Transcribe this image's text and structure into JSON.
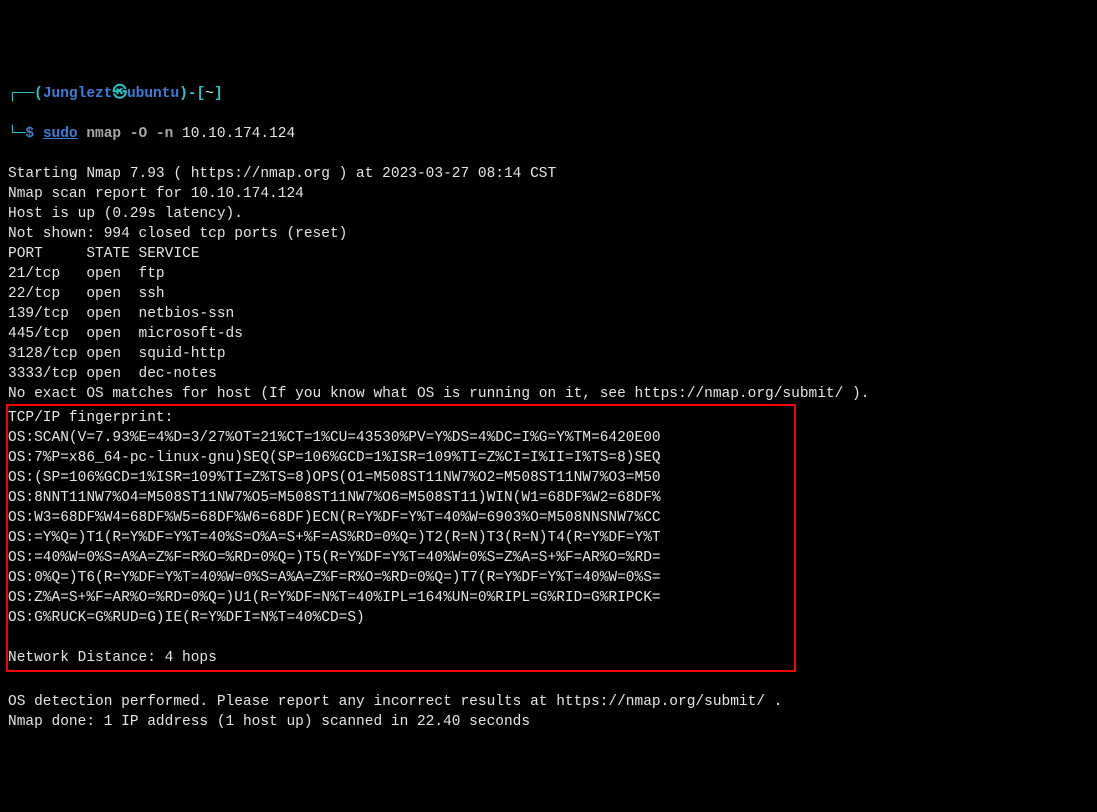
{
  "prompt1": {
    "bracket_open": "┌──(",
    "user": "Junglezt",
    "at": "㉿",
    "host": "ubuntu",
    "bracket_close": ")-[",
    "path": "~",
    "bracket_end": "]"
  },
  "prompt2": {
    "branch": "└─",
    "dollar": "$ ",
    "sudo": "sudo",
    "space1": " ",
    "cmd": "nmap -O -n",
    "space2": " ",
    "target": "10.10.174.124"
  },
  "output": {
    "line1": "Starting Nmap 7.93 ( https://nmap.org ) at 2023-03-27 08:14 CST",
    "line2": "Nmap scan report for 10.10.174.124",
    "line3": "Host is up (0.29s latency).",
    "line4": "Not shown: 994 closed tcp ports (reset)",
    "line5": "PORT     STATE SERVICE",
    "line6": "21/tcp   open  ftp",
    "line7": "22/tcp   open  ssh",
    "line8": "139/tcp  open  netbios-ssn",
    "line9": "445/tcp  open  microsoft-ds",
    "line10": "3128/tcp open  squid-http",
    "line11": "3333/tcp open  dec-notes",
    "line12": "No exact OS matches for host (If you know what OS is running on it, see https://nmap.org/submit/ )."
  },
  "boxed": {
    "l1": "TCP/IP fingerprint:",
    "l2": "OS:SCAN(V=7.93%E=4%D=3/27%OT=21%CT=1%CU=43530%PV=Y%DS=4%DC=I%G=Y%TM=6420E00",
    "l3": "OS:7%P=x86_64-pc-linux-gnu)SEQ(SP=106%GCD=1%ISR=109%TI=Z%CI=I%II=I%TS=8)SEQ",
    "l4": "OS:(SP=106%GCD=1%ISR=109%TI=Z%TS=8)OPS(O1=M508ST11NW7%O2=M508ST11NW7%O3=M50",
    "l5": "OS:8NNT11NW7%O4=M508ST11NW7%O5=M508ST11NW7%O6=M508ST11)WIN(W1=68DF%W2=68DF%",
    "l6": "OS:W3=68DF%W4=68DF%W5=68DF%W6=68DF)ECN(R=Y%DF=Y%T=40%W=6903%O=M508NNSNW7%CC",
    "l7": "OS:=Y%Q=)T1(R=Y%DF=Y%T=40%S=O%A=S+%F=AS%RD=0%Q=)T2(R=N)T3(R=N)T4(R=Y%DF=Y%T",
    "l8": "OS:=40%W=0%S=A%A=Z%F=R%O=%RD=0%Q=)T5(R=Y%DF=Y%T=40%W=0%S=Z%A=S+%F=AR%O=%RD=",
    "l9": "OS:0%Q=)T6(R=Y%DF=Y%T=40%W=0%S=A%A=Z%F=R%O=%RD=0%Q=)T7(R=Y%DF=Y%T=40%W=0%S=",
    "l10": "OS:Z%A=S+%F=AR%O=%RD=0%Q=)U1(R=Y%DF=N%T=40%IPL=164%UN=0%RIPL=G%RID=G%RIPCK=",
    "l11": "OS:G%RUCK=G%RUD=G)IE(R=Y%DFI=N%T=40%CD=S)",
    "blank": "",
    "l12": "Network Distance: 4 hops"
  },
  "after": {
    "l1": "OS detection performed. Please report any incorrect results at https://nmap.org/submit/ .",
    "l2": "Nmap done: 1 IP address (1 host up) scanned in 22.40 seconds"
  }
}
